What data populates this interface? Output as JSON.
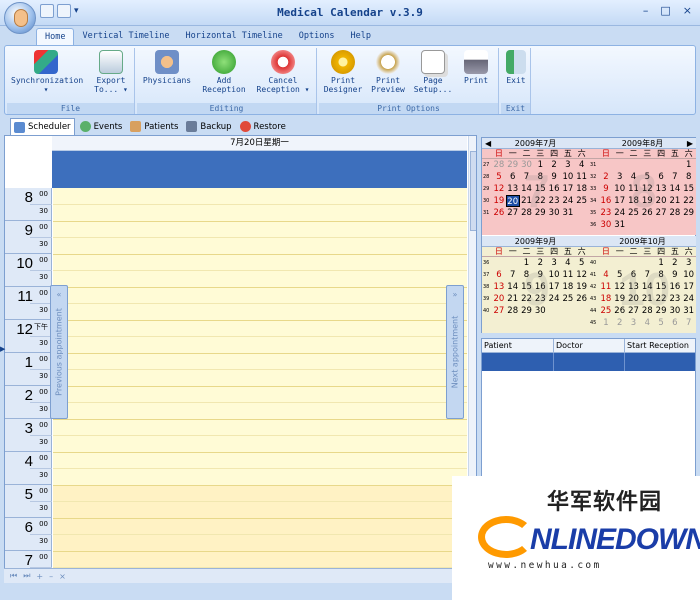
{
  "window": {
    "title": "Medical Calendar v.3.9",
    "min": "–",
    "max": "□",
    "close": "×"
  },
  "menu_tabs": [
    "Home",
    "Vertical Timeline",
    "Horizontal Timeline",
    "Options",
    "Help"
  ],
  "ribbon": {
    "groups": [
      "File",
      "Editing",
      "Print Options",
      "Exit"
    ],
    "buttons": {
      "sync": "Synchronization ▾",
      "export": "Export To... ▾",
      "physicians": "Physicians",
      "add": "Add Reception",
      "cancel": "Cancel Reception ▾",
      "print_designer": "Print Designer",
      "print_preview": "Print Preview",
      "page_setup": "Page Setup...",
      "print": "Print",
      "exit": "Exit"
    }
  },
  "view_tabs": [
    "Scheduler",
    "Events",
    "Patients",
    "Backup",
    "Restore"
  ],
  "scheduler": {
    "day_title": "7月20日星期一",
    "hours": [
      "8",
      "9",
      "10",
      "11",
      "12",
      "1",
      "2",
      "3",
      "4",
      "5",
      "6",
      "7"
    ],
    "minutes_top": "00",
    "minutes_half": "30",
    "noon_marker": "下午",
    "prev_label": "Previous appointment",
    "next_label": "Next appointment"
  },
  "calendar": {
    "weekdays": [
      "日",
      "一",
      "二",
      "三",
      "四",
      "五",
      "六"
    ],
    "months": [
      {
        "title": "2009年7月",
        "mark": "7",
        "weeks": [
          {
            "n": "27",
            "days": [
              [
                "28",
                "dim"
              ],
              [
                "29",
                "dim"
              ],
              [
                "30",
                "dim"
              ],
              [
                "1",
                ""
              ],
              [
                "2",
                ""
              ],
              [
                "3",
                ""
              ],
              [
                "4",
                ""
              ]
            ]
          },
          {
            "n": "28",
            "days": [
              [
                "5",
                "sun"
              ],
              [
                "6",
                ""
              ],
              [
                "7",
                ""
              ],
              [
                "8",
                ""
              ],
              [
                "9",
                ""
              ],
              [
                "10",
                ""
              ],
              [
                "11",
                ""
              ]
            ]
          },
          {
            "n": "29",
            "days": [
              [
                "12",
                "sun"
              ],
              [
                "13",
                ""
              ],
              [
                "14",
                ""
              ],
              [
                "15",
                ""
              ],
              [
                "16",
                ""
              ],
              [
                "17",
                ""
              ],
              [
                "18",
                ""
              ]
            ]
          },
          {
            "n": "30",
            "days": [
              [
                "19",
                "sun"
              ],
              [
                "20",
                "sel"
              ],
              [
                "21",
                ""
              ],
              [
                "22",
                ""
              ],
              [
                "23",
                ""
              ],
              [
                "24",
                ""
              ],
              [
                "25",
                ""
              ]
            ]
          },
          {
            "n": "31",
            "days": [
              [
                "26",
                "sun"
              ],
              [
                "27",
                ""
              ],
              [
                "28",
                ""
              ],
              [
                "29",
                ""
              ],
              [
                "30",
                ""
              ],
              [
                "31",
                ""
              ],
              [
                "",
                ""
              ]
            ]
          },
          {
            "n": "",
            "days": [
              [
                "",
                ""
              ],
              [
                "",
                ""
              ],
              [
                "",
                ""
              ],
              [
                "",
                ""
              ],
              [
                "",
                ""
              ],
              [
                "",
                ""
              ],
              [
                "",
                ""
              ]
            ]
          }
        ]
      },
      {
        "title": "2009年8月",
        "mark": "8",
        "weeks": [
          {
            "n": "31",
            "days": [
              [
                "",
                ""
              ],
              [
                "",
                ""
              ],
              [
                "",
                ""
              ],
              [
                "",
                ""
              ],
              [
                "",
                ""
              ],
              [
                "",
                ""
              ],
              [
                "1",
                ""
              ]
            ]
          },
          {
            "n": "32",
            "days": [
              [
                "2",
                "sun"
              ],
              [
                "3",
                ""
              ],
              [
                "4",
                ""
              ],
              [
                "5",
                ""
              ],
              [
                "6",
                ""
              ],
              [
                "7",
                ""
              ],
              [
                "8",
                ""
              ]
            ]
          },
          {
            "n": "33",
            "days": [
              [
                "9",
                "sun"
              ],
              [
                "10",
                ""
              ],
              [
                "11",
                ""
              ],
              [
                "12",
                ""
              ],
              [
                "13",
                ""
              ],
              [
                "14",
                ""
              ],
              [
                "15",
                ""
              ]
            ]
          },
          {
            "n": "34",
            "days": [
              [
                "16",
                "sun"
              ],
              [
                "17",
                ""
              ],
              [
                "18",
                ""
              ],
              [
                "19",
                ""
              ],
              [
                "20",
                ""
              ],
              [
                "21",
                ""
              ],
              [
                "22",
                ""
              ]
            ]
          },
          {
            "n": "35",
            "days": [
              [
                "23",
                "sun"
              ],
              [
                "24",
                ""
              ],
              [
                "25",
                ""
              ],
              [
                "26",
                ""
              ],
              [
                "27",
                ""
              ],
              [
                "28",
                ""
              ],
              [
                "29",
                ""
              ]
            ]
          },
          {
            "n": "36",
            "days": [
              [
                "30",
                "sun"
              ],
              [
                "31",
                ""
              ],
              [
                "",
                ""
              ],
              [
                "",
                ""
              ],
              [
                "",
                ""
              ],
              [
                "",
                ""
              ],
              [
                "",
                ""
              ]
            ]
          }
        ]
      },
      {
        "title": "2009年9月",
        "mark": "9",
        "weeks": [
          {
            "n": "36",
            "days": [
              [
                "",
                ""
              ],
              [
                "",
                ""
              ],
              [
                "1",
                ""
              ],
              [
                "2",
                ""
              ],
              [
                "3",
                ""
              ],
              [
                "4",
                ""
              ],
              [
                "5",
                ""
              ]
            ]
          },
          {
            "n": "37",
            "days": [
              [
                "6",
                "sun"
              ],
              [
                "7",
                ""
              ],
              [
                "8",
                ""
              ],
              [
                "9",
                ""
              ],
              [
                "10",
                ""
              ],
              [
                "11",
                ""
              ],
              [
                "12",
                ""
              ]
            ]
          },
          {
            "n": "38",
            "days": [
              [
                "13",
                "sun"
              ],
              [
                "14",
                ""
              ],
              [
                "15",
                ""
              ],
              [
                "16",
                ""
              ],
              [
                "17",
                ""
              ],
              [
                "18",
                ""
              ],
              [
                "19",
                ""
              ]
            ]
          },
          {
            "n": "39",
            "days": [
              [
                "20",
                "sun"
              ],
              [
                "21",
                ""
              ],
              [
                "22",
                ""
              ],
              [
                "23",
                ""
              ],
              [
                "24",
                ""
              ],
              [
                "25",
                ""
              ],
              [
                "26",
                ""
              ]
            ]
          },
          {
            "n": "40",
            "days": [
              [
                "27",
                "sun"
              ],
              [
                "28",
                ""
              ],
              [
                "29",
                ""
              ],
              [
                "30",
                ""
              ],
              [
                "",
                ""
              ],
              [
                "",
                ""
              ],
              [
                "",
                ""
              ]
            ]
          },
          {
            "n": "",
            "days": [
              [
                "",
                ""
              ],
              [
                "",
                ""
              ],
              [
                "",
                ""
              ],
              [
                "",
                ""
              ],
              [
                "",
                ""
              ],
              [
                "",
                ""
              ],
              [
                "",
                ""
              ]
            ]
          }
        ]
      },
      {
        "title": "2009年10月",
        "mark": "10",
        "weeks": [
          {
            "n": "40",
            "days": [
              [
                "",
                ""
              ],
              [
                "",
                ""
              ],
              [
                "",
                ""
              ],
              [
                "",
                ""
              ],
              [
                "1",
                ""
              ],
              [
                "2",
                ""
              ],
              [
                "3",
                ""
              ]
            ]
          },
          {
            "n": "41",
            "days": [
              [
                "4",
                "sun"
              ],
              [
                "5",
                ""
              ],
              [
                "6",
                ""
              ],
              [
                "7",
                ""
              ],
              [
                "8",
                ""
              ],
              [
                "9",
                ""
              ],
              [
                "10",
                ""
              ]
            ]
          },
          {
            "n": "42",
            "days": [
              [
                "11",
                "sun"
              ],
              [
                "12",
                ""
              ],
              [
                "13",
                ""
              ],
              [
                "14",
                ""
              ],
              [
                "15",
                ""
              ],
              [
                "16",
                ""
              ],
              [
                "17",
                ""
              ]
            ]
          },
          {
            "n": "43",
            "days": [
              [
                "18",
                "sun"
              ],
              [
                "19",
                ""
              ],
              [
                "20",
                ""
              ],
              [
                "21",
                ""
              ],
              [
                "22",
                ""
              ],
              [
                "23",
                ""
              ],
              [
                "24",
                ""
              ]
            ]
          },
          {
            "n": "44",
            "days": [
              [
                "25",
                "sun"
              ],
              [
                "26",
                ""
              ],
              [
                "27",
                ""
              ],
              [
                "28",
                ""
              ],
              [
                "29",
                ""
              ],
              [
                "30",
                ""
              ],
              [
                "31",
                ""
              ]
            ]
          },
          {
            "n": "45",
            "days": [
              [
                "1",
                "dim"
              ],
              [
                "2",
                "dim"
              ],
              [
                "3",
                "dim"
              ],
              [
                "4",
                "dim"
              ],
              [
                "5",
                "dim"
              ],
              [
                "6",
                "dim"
              ],
              [
                "7",
                "dim"
              ]
            ]
          }
        ]
      }
    ],
    "highlight_color": "#f7c6c6",
    "alt_color": "#f3efd2"
  },
  "reception_table": {
    "columns": [
      "Patient",
      "Doctor",
      "Start Reception"
    ]
  },
  "nav_buttons": [
    "⏮",
    "⏭",
    "+",
    "–",
    "×"
  ],
  "watermark": {
    "cn": "华军软件园",
    "en": "NLINEDOWN",
    "url": "www.newhua.com"
  }
}
